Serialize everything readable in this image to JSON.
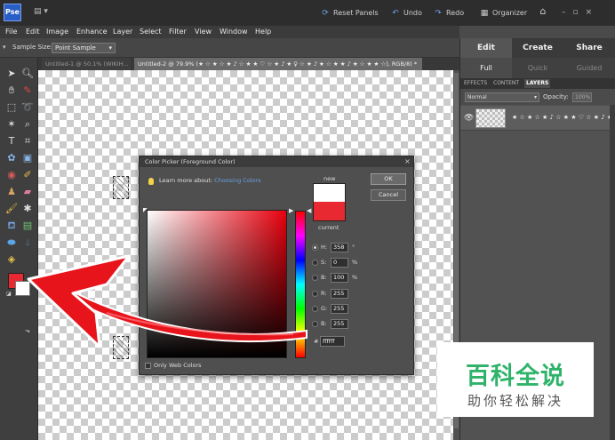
{
  "titlebar": {
    "logo": "Pse",
    "reset_panels": "Reset Panels",
    "undo": "Undo",
    "redo": "Redo",
    "organizer": "Organizer"
  },
  "menu": [
    "File",
    "Edit",
    "Image",
    "Enhance",
    "Layer",
    "Select",
    "Filter",
    "View",
    "Window",
    "Help"
  ],
  "options": {
    "sample_size_label": "Sample Size:",
    "sample_size_value": "Point Sample"
  },
  "doc_tabs": [
    "Untitled-1 @ 50.1% (WIKIH...",
    "Untitled-2 @ 79.9% (★ ☆ ★ ☆ ★ ♪ ☆ ★ ★ ♡ ☆ ★ ♪ ★ ♀ ☆ ★ ♪ ★ ☆ ★ ★ ♪ ★ ☆ ★ ★ ☆), RGB/8) *"
  ],
  "right_panel": {
    "modes": [
      "Edit",
      "Create",
      "Share"
    ],
    "sub_modes": [
      "Full",
      "Quick",
      "Guided"
    ],
    "panel_tabs": [
      "EFFECTS",
      "CONTENT",
      "LAYERS"
    ],
    "blend_mode": "Normal",
    "opacity_label": "Opacity:",
    "opacity_value": "100%",
    "layer_name": "★ ☆ ★ ☆ ★ ♪ ☆ ★ ★ ♡ ☆ ★ ♪ ★ ♀ ☆"
  },
  "picker": {
    "title": "Color Picker (Foreground Color)",
    "learn_prefix": "Learn more about:",
    "learn_link": "Choosing Colors",
    "new_label": "new",
    "current_label": "current",
    "ok": "OK",
    "cancel": "Cancel",
    "fields": [
      {
        "label": "H:",
        "value": "358",
        "unit": "°",
        "selected": true
      },
      {
        "label": "S:",
        "value": "0",
        "unit": "%",
        "selected": false
      },
      {
        "label": "B:",
        "value": "100",
        "unit": "%",
        "selected": false
      },
      {
        "label": "R:",
        "value": "255",
        "unit": "",
        "selected": false
      },
      {
        "label": "G:",
        "value": "255",
        "unit": "",
        "selected": false
      },
      {
        "label": "B:",
        "value": "255",
        "unit": "",
        "selected": false
      }
    ],
    "hex_label": "#",
    "hex_value": "ffffff",
    "only_web_colors": "Only Web Colors",
    "new_color": "#ffffff",
    "current_color": "#e92932"
  },
  "colors": {
    "foreground": "#e92932",
    "background": "#ffffff",
    "arrow": "#e8141c",
    "accent": "#2fb36a"
  },
  "watermark": {
    "title": "百科全说",
    "subtitle": "助你轻松解决"
  }
}
